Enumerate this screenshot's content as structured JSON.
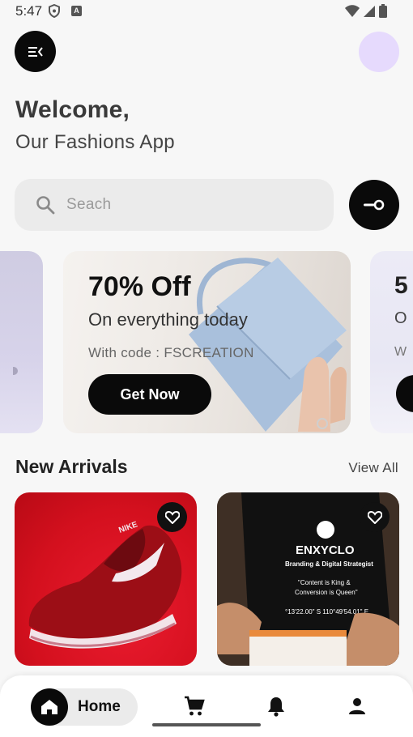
{
  "status_bar": {
    "time": "5:47"
  },
  "header": {
    "menu_icon": "menu-collapse-icon",
    "welcome": "Welcome,",
    "subtitle": "Our Fashions App"
  },
  "search": {
    "placeholder": "Seach",
    "filter_icon": "filter-key-icon"
  },
  "banner": {
    "title": "70% Off",
    "line2": "On everything today",
    "code": "With code : FSCREATION",
    "cta": "Get Now"
  },
  "banner_next": {
    "t1": "5",
    "t2": "O",
    "t3": "W"
  },
  "section": {
    "title": "New Arrivals",
    "view_all": "View All"
  },
  "products": [
    {
      "name": "red-sneaker",
      "logo": "NIKE"
    },
    {
      "name": "black-tshirt",
      "brand": "ENXYCLO",
      "tagline": "Branding & Digital Strategist",
      "quote1": "\"Content is King &",
      "quote2": "Conversion is Queen\"",
      "coords": "°13'22.00\" S 110°49'54.01\" E"
    }
  ],
  "nav": {
    "home_label": "Home"
  },
  "colors": {
    "accent": "#0a0a0a",
    "avatar": "#e6dafd",
    "card_red": "#d4101e"
  }
}
